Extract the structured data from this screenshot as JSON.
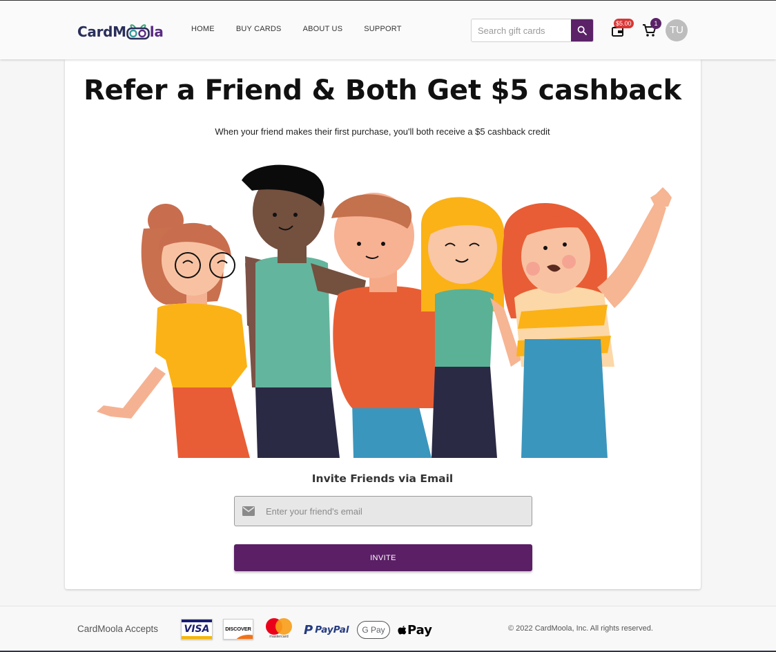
{
  "brand": {
    "logo_left": "CardM",
    "logo_right": "la"
  },
  "nav": [
    "HOME",
    "BUY CARDS",
    "ABOUT US",
    "SUPPORT"
  ],
  "search": {
    "placeholder": "Search gift cards"
  },
  "wallet": {
    "balance": "$5.00"
  },
  "cart": {
    "count": "1"
  },
  "user": {
    "initials": "TU"
  },
  "main": {
    "title": "Refer a Friend & Both Get $5 cashback",
    "subtitle": "When your friend makes their first purchase, you'll both receive a $5 cashback credit",
    "invite_heading": "Invite Friends via Email",
    "email_placeholder": "Enter your friend's email",
    "invite_button": "INVITE"
  },
  "footer": {
    "accepts_label": "CardMoola Accepts",
    "payment_methods": [
      "VISA",
      "DISCOVER",
      "mastercard",
      "PayPal",
      "G Pay",
      "Pay"
    ],
    "copyright": "© 2022 CardMoola, Inc. All rights reserved."
  },
  "colors": {
    "brand_purple": "#5b2268",
    "badge_red": "#d93535",
    "brand_navy": "#2a2f5a"
  }
}
